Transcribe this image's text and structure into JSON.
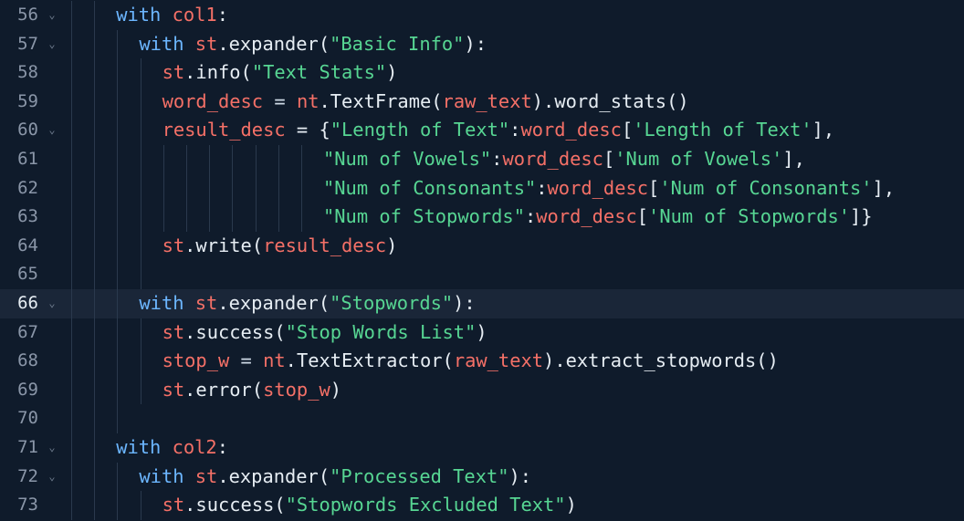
{
  "editor": {
    "lines": [
      {
        "number": "56",
        "fold": true,
        "active": false,
        "indent": 2,
        "guides": 2,
        "tokens": [
          {
            "t": "with ",
            "c": "kw"
          },
          {
            "t": "col1",
            "c": "var"
          },
          {
            "t": ":",
            "c": "pl"
          }
        ]
      },
      {
        "number": "57",
        "fold": true,
        "active": false,
        "indent": 3,
        "guides": 3,
        "tokens": [
          {
            "t": "with ",
            "c": "kw"
          },
          {
            "t": "st",
            "c": "var"
          },
          {
            "t": ".expander(",
            "c": "pl"
          },
          {
            "t": "\"Basic Info\"",
            "c": "str"
          },
          {
            "t": "):",
            "c": "pl"
          }
        ]
      },
      {
        "number": "58",
        "fold": false,
        "active": false,
        "indent": 4,
        "guides": 4,
        "tokens": [
          {
            "t": "st",
            "c": "var"
          },
          {
            "t": ".info(",
            "c": "pl"
          },
          {
            "t": "\"Text Stats\"",
            "c": "str"
          },
          {
            "t": ")",
            "c": "pl"
          }
        ]
      },
      {
        "number": "59",
        "fold": false,
        "active": false,
        "indent": 4,
        "guides": 4,
        "tokens": [
          {
            "t": "word_desc",
            "c": "var"
          },
          {
            "t": " = ",
            "c": "op"
          },
          {
            "t": "nt",
            "c": "var"
          },
          {
            "t": ".TextFrame(",
            "c": "pl"
          },
          {
            "t": "raw_text",
            "c": "var"
          },
          {
            "t": ").word_stats()",
            "c": "pl"
          }
        ]
      },
      {
        "number": "60",
        "fold": true,
        "active": false,
        "indent": 4,
        "guides": 4,
        "tokens": [
          {
            "t": "result_desc",
            "c": "var"
          },
          {
            "t": " = {",
            "c": "pl"
          },
          {
            "t": "\"Length of Text\"",
            "c": "str"
          },
          {
            "t": ":",
            "c": "pl"
          },
          {
            "t": "word_desc",
            "c": "var"
          },
          {
            "t": "[",
            "c": "pl"
          },
          {
            "t": "'Length of Text'",
            "c": "str"
          },
          {
            "t": "],",
            "c": "pl"
          }
        ]
      },
      {
        "number": "61",
        "fold": false,
        "active": false,
        "indent": 11,
        "guides": 11,
        "tokens": [
          {
            "t": "\"Num of Vowels\"",
            "c": "str"
          },
          {
            "t": ":",
            "c": "pl"
          },
          {
            "t": "word_desc",
            "c": "var"
          },
          {
            "t": "[",
            "c": "pl"
          },
          {
            "t": "'Num of Vowels'",
            "c": "str"
          },
          {
            "t": "],",
            "c": "pl"
          }
        ]
      },
      {
        "number": "62",
        "fold": false,
        "active": false,
        "indent": 11,
        "guides": 11,
        "tokens": [
          {
            "t": "\"Num of Consonants\"",
            "c": "str"
          },
          {
            "t": ":",
            "c": "pl"
          },
          {
            "t": "word_desc",
            "c": "var"
          },
          {
            "t": "[",
            "c": "pl"
          },
          {
            "t": "'Num of Consonants'",
            "c": "str"
          },
          {
            "t": "],",
            "c": "pl"
          }
        ]
      },
      {
        "number": "63",
        "fold": false,
        "active": false,
        "indent": 11,
        "guides": 11,
        "tokens": [
          {
            "t": "\"Num of Stopwords\"",
            "c": "str"
          },
          {
            "t": ":",
            "c": "pl"
          },
          {
            "t": "word_desc",
            "c": "var"
          },
          {
            "t": "[",
            "c": "pl"
          },
          {
            "t": "'Num of Stopwords'",
            "c": "str"
          },
          {
            "t": "]}",
            "c": "pl"
          }
        ]
      },
      {
        "number": "64",
        "fold": false,
        "active": false,
        "indent": 4,
        "guides": 4,
        "tokens": [
          {
            "t": "st",
            "c": "var"
          },
          {
            "t": ".write(",
            "c": "pl"
          },
          {
            "t": "result_desc",
            "c": "var"
          },
          {
            "t": ")",
            "c": "pl"
          }
        ]
      },
      {
        "number": "65",
        "fold": false,
        "active": false,
        "indent": 0,
        "guides": 4,
        "tokens": []
      },
      {
        "number": "66",
        "fold": true,
        "active": true,
        "indent": 3,
        "guides": 3,
        "tokens": [
          {
            "t": "with ",
            "c": "kw"
          },
          {
            "t": "st",
            "c": "var"
          },
          {
            "t": ".expander(",
            "c": "pl"
          },
          {
            "t": "\"Stopwords\"",
            "c": "str"
          },
          {
            "t": "):",
            "c": "pl"
          }
        ]
      },
      {
        "number": "67",
        "fold": false,
        "active": false,
        "indent": 4,
        "guides": 4,
        "tokens": [
          {
            "t": "st",
            "c": "var"
          },
          {
            "t": ".success(",
            "c": "pl"
          },
          {
            "t": "\"Stop Words List\"",
            "c": "str"
          },
          {
            "t": ")",
            "c": "pl"
          }
        ]
      },
      {
        "number": "68",
        "fold": false,
        "active": false,
        "indent": 4,
        "guides": 4,
        "tokens": [
          {
            "t": "stop_w",
            "c": "var"
          },
          {
            "t": " = ",
            "c": "op"
          },
          {
            "t": "nt",
            "c": "var"
          },
          {
            "t": ".TextExtractor(",
            "c": "pl"
          },
          {
            "t": "raw_text",
            "c": "var"
          },
          {
            "t": ").extract_stopwords()",
            "c": "pl"
          }
        ]
      },
      {
        "number": "69",
        "fold": false,
        "active": false,
        "indent": 4,
        "guides": 4,
        "tokens": [
          {
            "t": "st",
            "c": "var"
          },
          {
            "t": ".error(",
            "c": "pl"
          },
          {
            "t": "stop_w",
            "c": "var"
          },
          {
            "t": ")",
            "c": "pl"
          }
        ]
      },
      {
        "number": "70",
        "fold": false,
        "active": false,
        "indent": 0,
        "guides": 3,
        "tokens": []
      },
      {
        "number": "71",
        "fold": true,
        "active": false,
        "indent": 2,
        "guides": 2,
        "tokens": [
          {
            "t": "with ",
            "c": "kw"
          },
          {
            "t": "col2",
            "c": "var"
          },
          {
            "t": ":",
            "c": "pl"
          }
        ]
      },
      {
        "number": "72",
        "fold": true,
        "active": false,
        "indent": 3,
        "guides": 3,
        "tokens": [
          {
            "t": "with ",
            "c": "kw"
          },
          {
            "t": "st",
            "c": "var"
          },
          {
            "t": ".expander(",
            "c": "pl"
          },
          {
            "t": "\"Processed Text\"",
            "c": "str"
          },
          {
            "t": "):",
            "c": "pl"
          }
        ]
      },
      {
        "number": "73",
        "fold": false,
        "active": false,
        "indent": 4,
        "guides": 4,
        "tokens": [
          {
            "t": "st",
            "c": "var"
          },
          {
            "t": ".success(",
            "c": "pl"
          },
          {
            "t": "\"Stopwords Excluded Text\"",
            "c": "str"
          },
          {
            "t": ")",
            "c": "pl"
          }
        ]
      }
    ],
    "fold_icon": "chevron-down-icon",
    "colors": {
      "background": "#0f1b2b",
      "active_line": "#1a2638",
      "keyword": "#6cb6ff",
      "variable": "#f47067",
      "string": "#57d693",
      "plain": "#e6edf3",
      "line_number": "#8a96a8"
    }
  }
}
